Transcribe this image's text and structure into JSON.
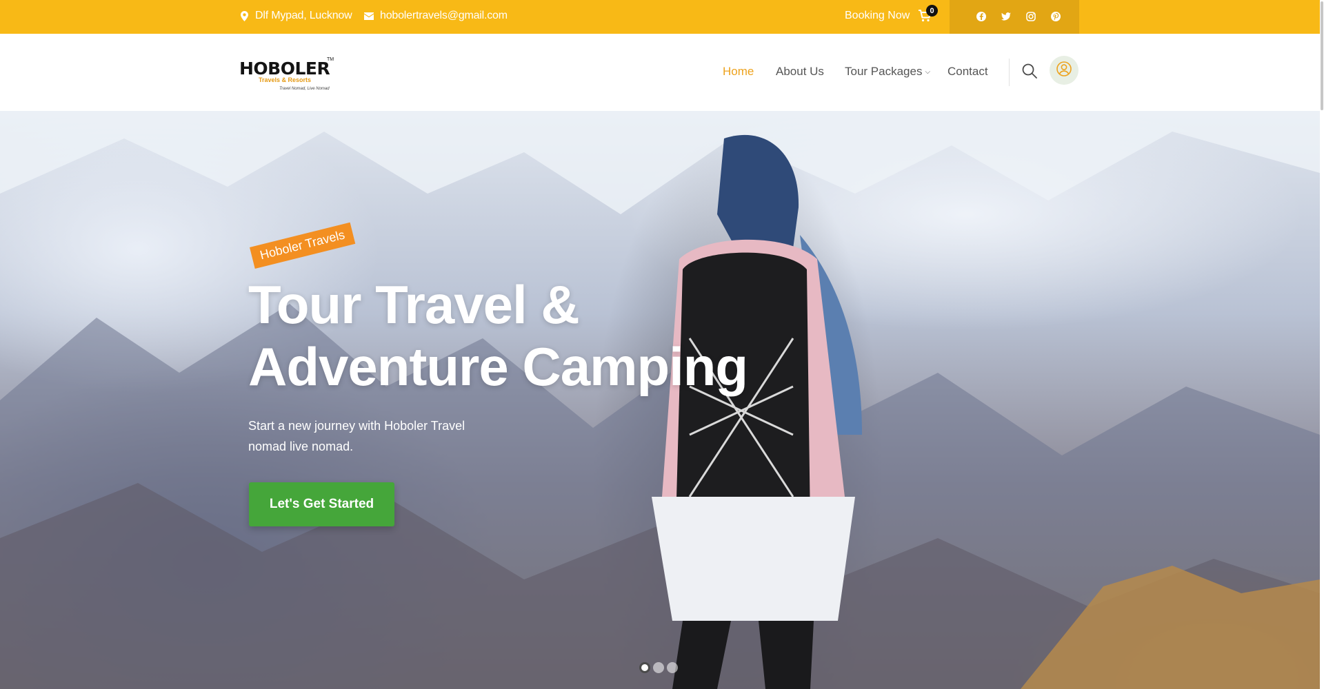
{
  "topbar": {
    "address": "Dlf Mypad, Lucknow",
    "email": "hobolertravels@gmail.com",
    "booking_label": "Booking Now",
    "cart_count": "0",
    "social": [
      "facebook-icon",
      "twitter-icon",
      "instagram-icon",
      "pinterest-icon"
    ],
    "bg_color": "#f8b916"
  },
  "logo": {
    "main": "HOBOLER",
    "tm": "TM",
    "subtitle": "Travels & Resorts",
    "tagline": "Travel Nomad, Live Nomad"
  },
  "nav": {
    "items": [
      {
        "label": "Home",
        "active": true
      },
      {
        "label": "About Us",
        "active": false
      },
      {
        "label": "Tour Packages",
        "active": false,
        "has_dropdown": true
      },
      {
        "label": "Contact",
        "active": false
      }
    ],
    "active_color": "#eda21d"
  },
  "hero": {
    "tag": "Hoboler Travels",
    "title_line1": "Tour Travel &",
    "title_line2": "Adventure Camping",
    "subtitle": "Start a new journey with Hoboler Travel nomad live nomad.",
    "cta": "Let's Get Started",
    "cta_color": "#45a63a",
    "tag_color": "#f38f21",
    "slides": 3,
    "active_slide": 1
  }
}
